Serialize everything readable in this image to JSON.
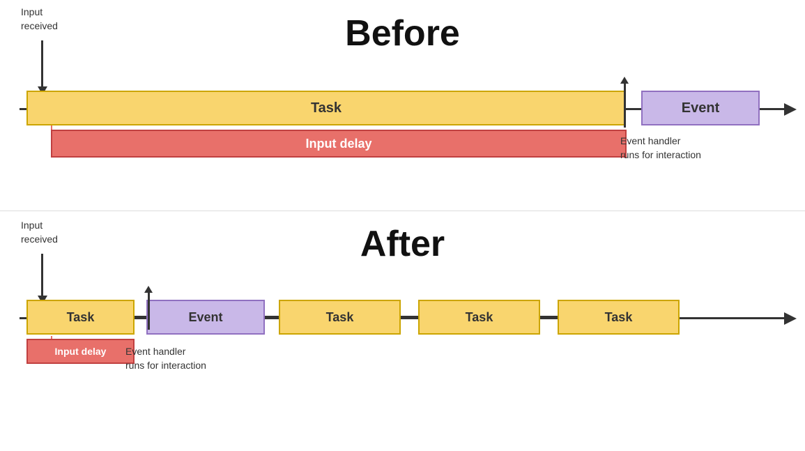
{
  "before": {
    "title": "Before",
    "input_received_label": "Input\nreceived",
    "task_label": "Task",
    "event_label": "Event",
    "input_delay_label": "Input delay",
    "event_handler_label": "Event handler\nruns for interaction"
  },
  "after": {
    "title": "After",
    "input_received_label": "Input\nreceived",
    "task_label_1": "Task",
    "event_label": "Event",
    "task_label_2": "Task",
    "task_label_3": "Task",
    "task_label_4": "Task",
    "input_delay_label": "Input delay",
    "event_handler_label": "Event handler\nruns for interaction"
  }
}
